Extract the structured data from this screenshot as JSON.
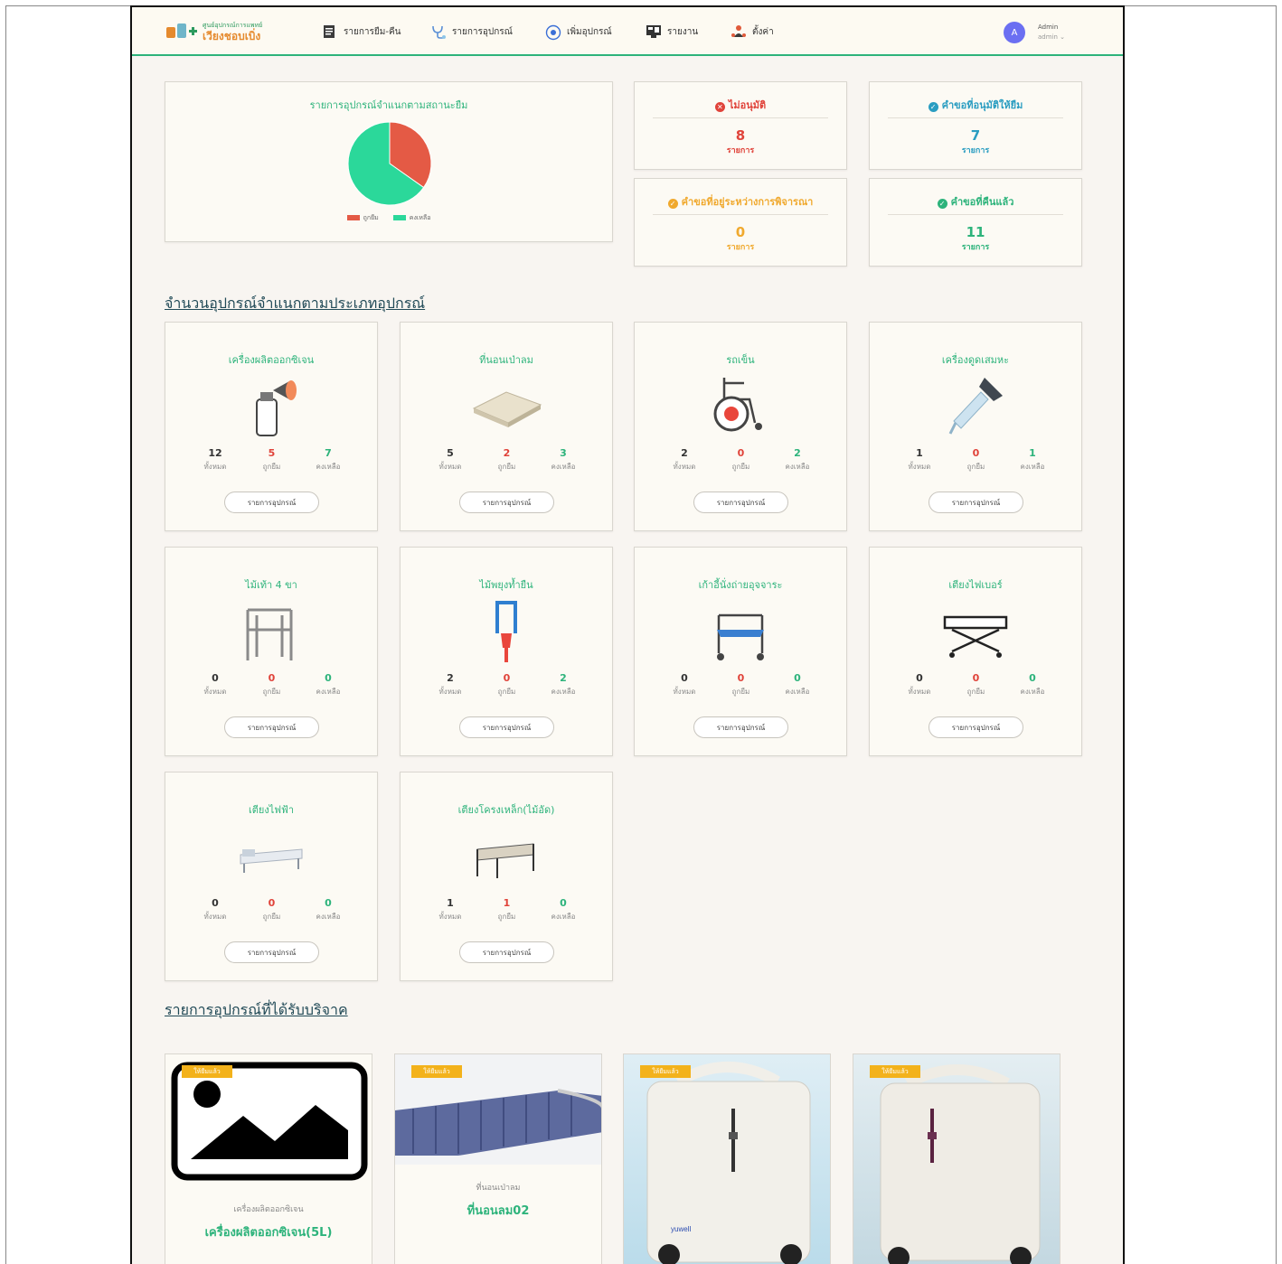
{
  "app": {
    "logo_line1": "ศูนย์อุปกรณ์การแพทย์",
    "logo_line2": "เวียงชอบเบิ่ง"
  },
  "nav": {
    "items": [
      {
        "label": "รายการยืม-คืน",
        "icon": "list-document-icon"
      },
      {
        "label": "รายการอุปกรณ์",
        "icon": "stethoscope-icon"
      },
      {
        "label": "เพิ่มอุปกรณ์",
        "icon": "add-circle-icon"
      },
      {
        "label": "รายงาน",
        "icon": "report-monitor-icon"
      },
      {
        "label": "ตั้งค่า",
        "icon": "users-settings-icon"
      }
    ]
  },
  "user": {
    "initial": "A",
    "name": "Admin",
    "role": "admin"
  },
  "pie": {
    "title": "รายการอุปกรณ์จำแนกตามสถานะยืม",
    "legend": [
      "ถูกยืม",
      "คงเหลือ"
    ]
  },
  "chart_data": {
    "type": "pie",
    "title": "รายการอุปกรณ์จำแนกตามสถานะยืม",
    "categories": [
      "ถูกยืม",
      "คงเหลือ"
    ],
    "values": [
      8,
      15
    ],
    "colors": [
      "#e45a45",
      "#2bd89a"
    ]
  },
  "stats": [
    {
      "title": "ไม่อนุมัติ",
      "value": "8",
      "unit": "รายการ",
      "color": "#e0433a",
      "icon": "x-circle-icon"
    },
    {
      "title": "คำขอที่อนุมัติให้ยืม",
      "value": "7",
      "unit": "รายการ",
      "color": "#2a9dc1",
      "icon": "check-circle-icon"
    },
    {
      "title": "คำขอที่อยู่ระหว่างการพิจารณา",
      "value": "0",
      "unit": "รายการ",
      "color": "#f0a92e",
      "icon": "pending-circle-icon"
    },
    {
      "title": "คำขอที่คืนแล้ว",
      "value": "11",
      "unit": "รายการ",
      "color": "#2db37b",
      "icon": "check-circle-icon"
    }
  ],
  "equipment_section_title": "จำนวนอุปกรณ์จำแนกตามประเภทอุปกรณ์",
  "stat_labels": {
    "total": "ทั้งหมด",
    "borrowed": "ถูกยืม",
    "remaining": "คงเหลือ"
  },
  "equipment": [
    {
      "name": "เครื่องผลิตออกซิเจน",
      "total": "12",
      "borrowed": "5",
      "remaining": "7",
      "button": "รายการอุปกรณ์",
      "icon": "oxygen-concentrator-icon"
    },
    {
      "name": "ที่นอนเป่าลม",
      "total": "5",
      "borrowed": "2",
      "remaining": "3",
      "button": "รายการอุปกรณ์",
      "icon": "air-mattress-icon"
    },
    {
      "name": "รถเข็น",
      "total": "2",
      "borrowed": "0",
      "remaining": "2",
      "button": "รายการอุปกรณ์",
      "icon": "wheelchair-icon"
    },
    {
      "name": "เครื่องดูดเสมหะ",
      "total": "1",
      "borrowed": "0",
      "remaining": "1",
      "button": "รายการอุปกรณ์",
      "icon": "suction-dropper-icon"
    },
    {
      "name": "ไม้เท้า 4 ขา",
      "total": "0",
      "borrowed": "0",
      "remaining": "0",
      "button": "รายการอุปกรณ์",
      "icon": "walker-icon"
    },
    {
      "name": "ไม้พยุงท้ำยืน",
      "total": "2",
      "borrowed": "0",
      "remaining": "2",
      "button": "รายการอุปกรณ์",
      "icon": "crutches-icon"
    },
    {
      "name": "เก้าอี้นั่งถ่ายอุจจาระ",
      "total": "0",
      "borrowed": "0",
      "remaining": "0",
      "button": "รายการอุปกรณ์",
      "icon": "commode-chair-icon"
    },
    {
      "name": "เตียงไฟเบอร์",
      "total": "0",
      "borrowed": "0",
      "remaining": "0",
      "button": "รายการอุปกรณ์",
      "icon": "stretcher-bed-icon"
    },
    {
      "name": "เตียงไฟฟ้า",
      "total": "0",
      "borrowed": "0",
      "remaining": "0",
      "button": "รายการอุปกรณ์",
      "icon": "electric-bed-icon"
    },
    {
      "name": "เตียงโครงเหล็ก(ไม้อัด)",
      "total": "1",
      "borrowed": "1",
      "remaining": "0",
      "button": "รายการอุปกรณ์",
      "icon": "steel-bed-icon"
    }
  ],
  "donation_section_title": "รายการอุปกรณ์ที่ได้รับบริจาค",
  "donations": [
    {
      "badge": "ให้ยืมแล้ว",
      "category": "เครื่องผลิตออกซิเจน",
      "name": "เครื่องผลิตออกซิเจน(5L)",
      "icon": "image-placeholder-icon"
    },
    {
      "badge": "ให้ยืมแล้ว",
      "category": "ที่นอนเป่าลม",
      "name": "ที่นอนลม02",
      "icon": "air-mattress-photo"
    },
    {
      "badge": "ให้ยืมแล้ว",
      "icon": "oxygen-concentrator-photo"
    },
    {
      "badge": "ให้ยืมแล้ว",
      "icon": "oxygen-concentrator-photo"
    }
  ]
}
